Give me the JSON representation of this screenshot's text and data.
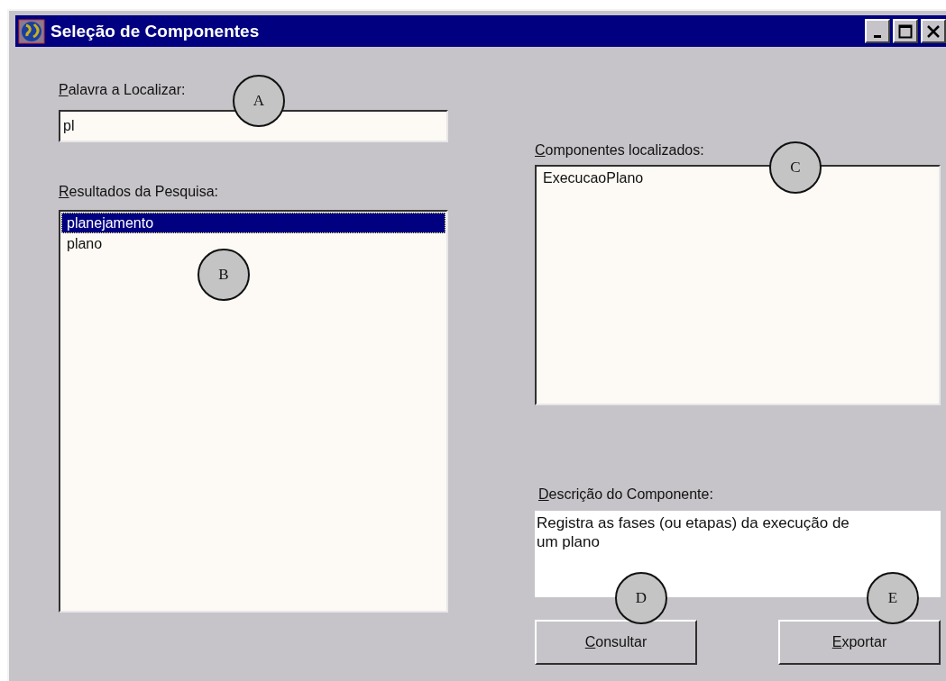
{
  "window": {
    "title": "Seleção de Componentes"
  },
  "search": {
    "label": "Palavra a Localizar:",
    "value": "pl"
  },
  "results": {
    "label": "Resultados da Pesquisa:",
    "items": [
      {
        "text": "planejamento",
        "selected": true
      },
      {
        "text": "plano",
        "selected": false
      }
    ]
  },
  "components": {
    "label": "Componentes localizados:",
    "items": [
      {
        "text": "ExecucaoPlano",
        "selected": false
      }
    ]
  },
  "description": {
    "label": "Descrição do Componente:",
    "text": "Registra as fases (ou etapas) da execução de um plano"
  },
  "buttons": [
    {
      "label": "Consultar"
    },
    {
      "label": "Exportar"
    }
  ],
  "callouts": [
    {
      "label": "A"
    },
    {
      "label": "B"
    },
    {
      "label": "C"
    },
    {
      "label": "D"
    },
    {
      "label": "E"
    }
  ]
}
